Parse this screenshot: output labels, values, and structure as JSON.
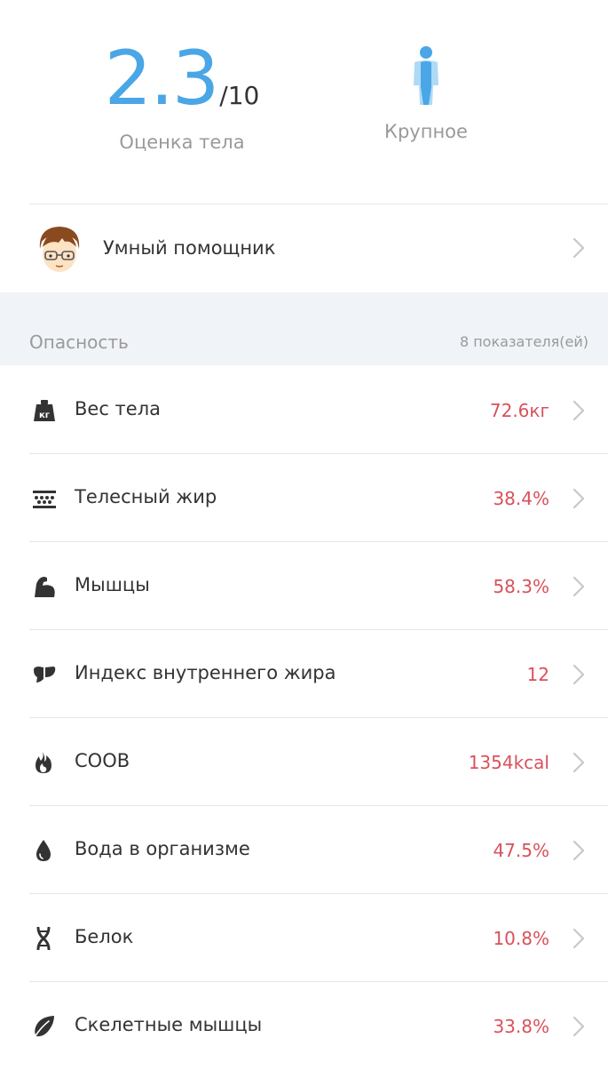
{
  "header": {
    "score": "2.3",
    "score_max": "/10",
    "score_label": "Оценка тела",
    "body_type_label": "Крупное",
    "body_type_icon": "body-figure-icon"
  },
  "assistant": {
    "label": "Умный помощник",
    "avatar": "avatar-boy-glasses"
  },
  "risk_section": {
    "title": "Опасность",
    "count": "8 показателя(ей)"
  },
  "metrics": [
    {
      "label": "Вес тела",
      "value": "72.6кг",
      "icon": "weight-icon"
    },
    {
      "label": "Телесный жир",
      "value": "38.4%",
      "icon": "body-fat-icon"
    },
    {
      "label": "Мышцы",
      "value": "58.3%",
      "icon": "muscle-icon"
    },
    {
      "label": "Индекс внутреннего жира",
      "value": "12",
      "icon": "visceral-fat-icon"
    },
    {
      "label": "СООВ",
      "value": "1354kcal",
      "icon": "flame-icon"
    },
    {
      "label": "Вода в организме",
      "value": "47.5%",
      "icon": "water-drop-icon"
    },
    {
      "label": "Белок",
      "value": "10.8%",
      "icon": "dna-icon"
    },
    {
      "label": "Скелетные мышцы",
      "value": "33.8%",
      "icon": "leaf-icon"
    }
  ],
  "colors": {
    "accent": "#4aa6e6",
    "danger": "#d9515c",
    "section_bg": "#f0f3f7"
  }
}
